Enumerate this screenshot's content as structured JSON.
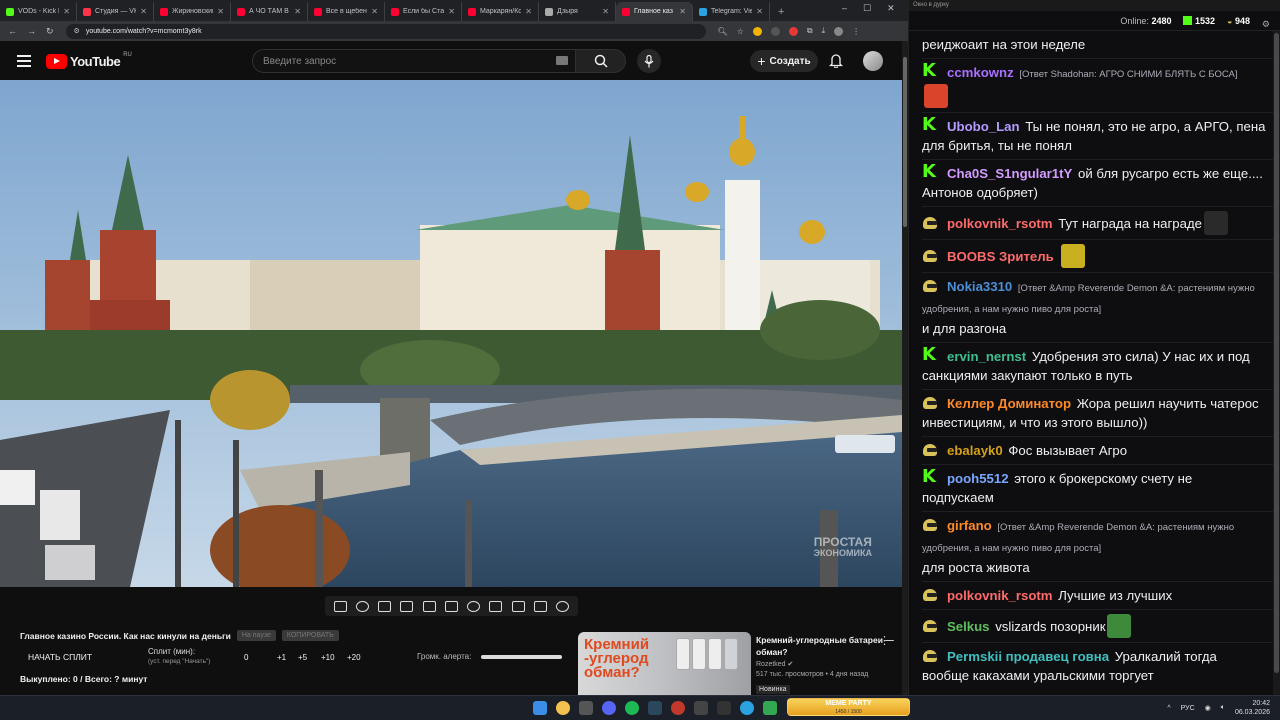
{
  "browser": {
    "tabs": [
      {
        "title": "VODs - Kick Da",
        "color": "#53fc18",
        "active": false
      },
      {
        "title": "Студия — VK В",
        "color": "#ff3347",
        "active": false
      },
      {
        "title": "Жириновский",
        "color": "#ff0033",
        "active": false
      },
      {
        "title": "А ЧО ТАМ В СШ",
        "color": "#ff0033",
        "active": false
      },
      {
        "title": "Все в щебень",
        "color": "#ff0033",
        "active": false
      },
      {
        "title": "Если бы Стали",
        "color": "#ff0033",
        "active": false
      },
      {
        "title": "Маркарян/Кон",
        "color": "#ff0033",
        "active": false
      },
      {
        "title": "Дзыря",
        "color": "#aaaaaa",
        "active": false
      },
      {
        "title": "Главное каз",
        "color": "#ff0033",
        "active": true
      },
      {
        "title": "Telegram: View",
        "color": "#2aa3e0",
        "active": false
      }
    ],
    "url": "youtube.com/watch?v=mcmomt3y8rk",
    "window_controls": [
      "–",
      "☐",
      "✕"
    ]
  },
  "youtube": {
    "logo_text": "YouTube",
    "country_code": "RU",
    "search_placeholder": "Введите запрос",
    "create_label": "Создать",
    "watermark_line1": "ПРОСТАЯ",
    "watermark_line2": "ЭКОНОМИКА"
  },
  "below_video": {
    "title": "Главное казино России. Как нас кинули на деньги",
    "pill_1": "На паузе",
    "pill_2": "КОПИРОВАТЬ",
    "start_split": "НАЧАТЬ СПЛИТ",
    "split_min_label": "Сплит (мин):",
    "split_min_hint": "(уст. перед \"Начать\")",
    "split_values": [
      "0",
      "+1",
      "+5",
      "+10",
      "+20"
    ],
    "volume_label": "Громк. алерта:",
    "spent": "Выкуплено: 0 / Всего: ? минут"
  },
  "recommended": {
    "thumb_line1": "Кремний",
    "thumb_line2": "-углерод",
    "thumb_line3": "обман?",
    "title": "Кремний-углеродные батареи — обман?",
    "channel": "Rozetked",
    "meta": "517 тыс. просмотров • 4 дня назад",
    "badge": "Новинка"
  },
  "chat": {
    "window_title": "Окно в дурку",
    "online_label": "Online:",
    "online_count": "2480",
    "kick_count": "1532",
    "gold_count": "948",
    "messages": [
      {
        "badge": "",
        "user": "",
        "color": "#efeff1",
        "reply": "",
        "text": "реиджоаит на этои неделе"
      },
      {
        "badge": "kick",
        "user": "ccmkownz",
        "color": "#a970ff",
        "reply": "[Ответ Shadohan: АГРО СНИМИ БЛЯТЬ С БОСА]",
        "text": ""
      },
      {
        "badge": "kick",
        "user": "Ubobo_Lan",
        "color": "#b49cff",
        "reply": "",
        "text": "Ты не понял, это не агро, а АРГО, пена для бритья, ты не понял"
      },
      {
        "badge": "kick",
        "user": "Cha0S_S1ngular1tY",
        "color": "#d49bff",
        "reply": "",
        "text": "ой бля русагро есть же еще.... Антонов одобряет)"
      },
      {
        "badge": "hat",
        "user": "polkovnik_rsotm",
        "color": "#ff6b6b",
        "reply": "",
        "text": "Тут награда на награде"
      },
      {
        "badge": "hat",
        "user": "BOOBS Зритель",
        "color": "#ff6b6b",
        "reply": "",
        "text": ""
      },
      {
        "badge": "hat",
        "user": "Nokia3310",
        "color": "#4b8fd6",
        "reply": "[Ответ &Amp Reverende Demon &A: растениям нужно удобрения, а нам нужно пиво для роста]",
        "text": "и для разгона"
      },
      {
        "badge": "kick",
        "user": "ervin_nernst",
        "color": "#3fbf8f",
        "reply": "",
        "text": "Удобрения это сила) У нас их и под санкциями закупают только в путь"
      },
      {
        "badge": "hat",
        "user": "Келлер Доминатор",
        "color": "#ff8a2a",
        "reply": "",
        "text": "Жора решил научить чатерос инвестициям, и что из этого вышло))"
      },
      {
        "badge": "hat",
        "user": "ebalayk0",
        "color": "#d4a017",
        "reply": "",
        "text": "Фос вызывает Агро"
      },
      {
        "badge": "kick",
        "user": "pooh5512",
        "color": "#7aa7ff",
        "reply": "",
        "text": "этого к брокерскому счету не подпускаем"
      },
      {
        "badge": "hat",
        "user": "girfano",
        "color": "#ff8a2a",
        "reply": "[Ответ &Amp Reverende Demon &A: растениям нужно удобрения, а нам нужно пиво для роста]",
        "text": "для роста живота"
      },
      {
        "badge": "hat",
        "user": "polkovnik_rsotm",
        "color": "#ff6b6b",
        "reply": "",
        "text": "Лучшие из лучших"
      },
      {
        "badge": "hat",
        "user": "Selkus",
        "color": "#5fbf5f",
        "reply": "",
        "text": "vslizards позорник"
      },
      {
        "badge": "hat",
        "user": "Permskii продавец говна",
        "color": "#3fbfbf",
        "reply": "",
        "text": "Уралкалий тогда вообще какахами уральскими торгует"
      }
    ]
  },
  "taskbar": {
    "meme_title": "MEME PARTY",
    "meme_sub": "1450 / 1500",
    "lang": "РУС",
    "time": "20:42",
    "date": "06.03.2026"
  }
}
